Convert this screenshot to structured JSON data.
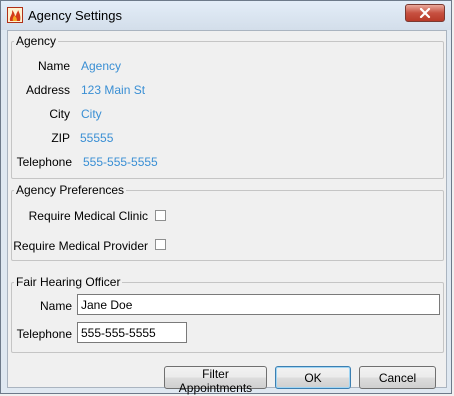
{
  "window": {
    "title": "Agency Settings",
    "app_icon": "flame-icon",
    "close_icon": "close-icon"
  },
  "agency": {
    "legend": "Agency",
    "name_label": "Name",
    "name_value": "Agency",
    "address_label": "Address",
    "address_value": "123 Main St",
    "city_label": "City",
    "city_value": "City",
    "zip_label": "ZIP",
    "zip_value": "55555",
    "telephone_label": "Telephone",
    "telephone_value": "555-555-5555"
  },
  "preferences": {
    "legend": "Agency Preferences",
    "require_clinic_label": "Require Medical Clinic",
    "require_clinic_checked": false,
    "require_provider_label": "Require Medical Provider",
    "require_provider_checked": false
  },
  "officer": {
    "legend": "Fair Hearing Officer",
    "name_label": "Name",
    "name_value": "Jane Doe",
    "telephone_label": "Telephone",
    "telephone_value": "555-555-5555"
  },
  "buttons": {
    "filter_label": "Filter Appointments",
    "ok_label": "OK",
    "cancel_label": "Cancel"
  },
  "colors": {
    "value_text": "#3a8fd4",
    "close_button": "#c75040"
  }
}
